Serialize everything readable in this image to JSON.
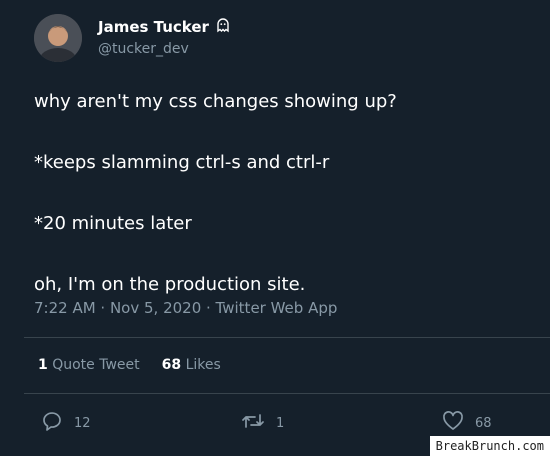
{
  "author": {
    "name": "James Tucker",
    "handle": "@tucker_dev",
    "badge_icon": "ghost-icon"
  },
  "tweet": {
    "lines": [
      "why aren't my css changes showing up?",
      "*keeps slamming ctrl-s and ctrl-r",
      "*20 minutes later",
      "oh, I'm on the production site."
    ],
    "timestamp": "7:22 AM · Nov 5, 2020 · Twitter Web App"
  },
  "stats": {
    "quote_count": "1",
    "quote_label": "Quote Tweet",
    "likes_count": "68",
    "likes_label": "Likes"
  },
  "actions": {
    "reply_count": "12",
    "retweet_count": "1",
    "like_count": "68"
  },
  "watermark": "BreakBrunch.com",
  "colors": {
    "background": "#15202b",
    "text_primary": "#ffffff",
    "text_secondary": "#8899a6",
    "divider": "#38444d"
  }
}
